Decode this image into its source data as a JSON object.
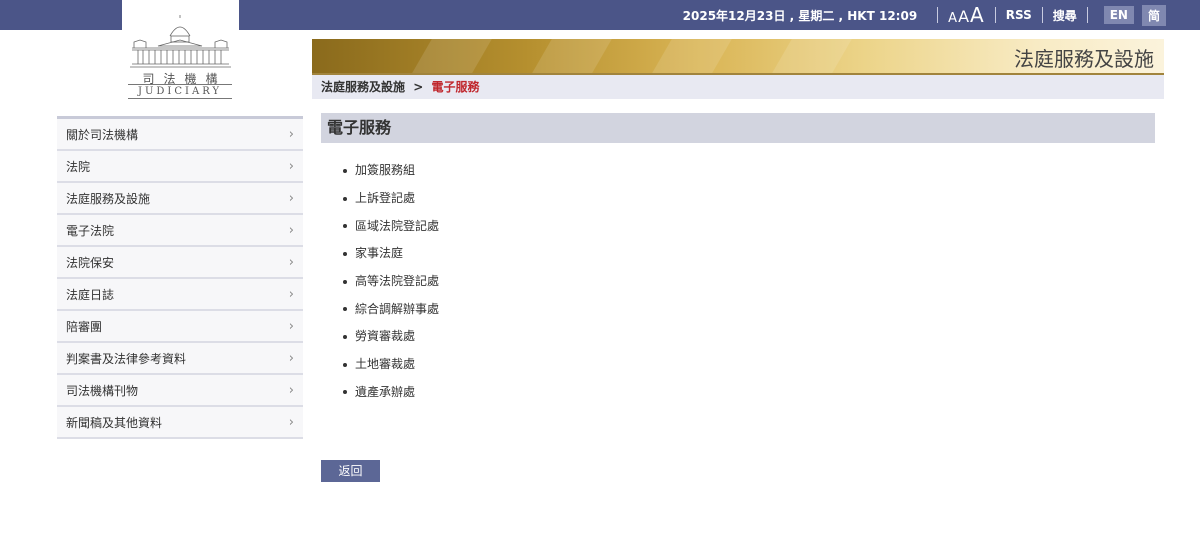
{
  "topbar": {
    "date": "2025年12月23日 , 星期二 , HKT 12:09",
    "font_sizes": [
      "A",
      "A",
      "A"
    ],
    "rss": "RSS",
    "search": "搜尋",
    "lang_en": "EN",
    "lang_sc": "简"
  },
  "logo": {
    "name_cn": "司法機構",
    "name_en": "JUDICIARY"
  },
  "banner": {
    "title": "法庭服務及設施"
  },
  "breadcrumb": {
    "parent": "法庭服務及設施",
    "separator": ">",
    "current": "電子服務"
  },
  "sidebar": {
    "items": [
      {
        "label": "關於司法機構"
      },
      {
        "label": "法院"
      },
      {
        "label": "法庭服務及設施"
      },
      {
        "label": "電子法院"
      },
      {
        "label": "法院保安"
      },
      {
        "label": "法庭日誌"
      },
      {
        "label": "陪審團"
      },
      {
        "label": "判案書及法律參考資料"
      },
      {
        "label": "司法機構刊物"
      },
      {
        "label": "新聞稿及其他資料"
      }
    ]
  },
  "main": {
    "title": "電子服務",
    "services": [
      "加簽服務組",
      "上訴登記處",
      "區域法院登記處",
      "家事法庭",
      "高等法院登記處",
      "綜合調解辦事處",
      "勞資審裁處",
      "土地審裁處",
      "遺產承辦處"
    ],
    "back_label": "返回"
  },
  "colors": {
    "topbar": "#4b5588",
    "breadcrumb_current": "#c0272d",
    "back_button": "#5c6796"
  }
}
